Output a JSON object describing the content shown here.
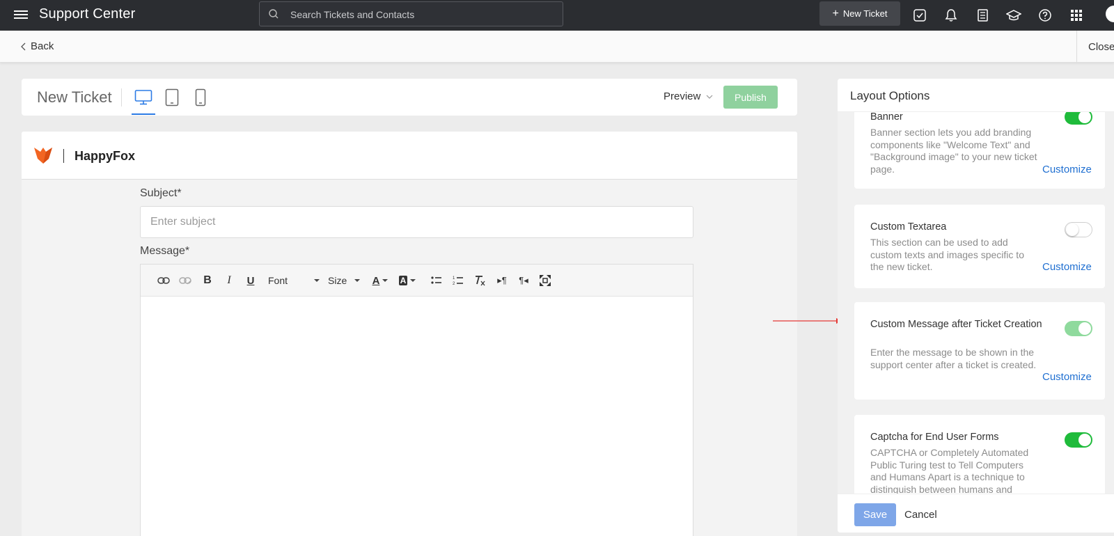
{
  "topbar": {
    "title": "Support Center",
    "search_placeholder": "Search Tickets and Contacts",
    "new_ticket_label": "New Ticket"
  },
  "subbar": {
    "back_label": "Back",
    "close_label": "Close"
  },
  "builder": {
    "title": "New Ticket",
    "preview_label": "Preview",
    "publish_label": "Publish",
    "devices": [
      "desktop",
      "tablet",
      "mobile"
    ],
    "active_device": "desktop"
  },
  "form": {
    "brand_name": "HappyFox",
    "subject_label": "Subject*",
    "subject_placeholder": "Enter subject",
    "message_label": "Message*",
    "font_label": "Font",
    "size_label": "Size"
  },
  "layout_options": {
    "title": "Layout Options",
    "items": [
      {
        "title": "Banner",
        "description": "Banner section lets you add branding components like \"Welcome Text\" and \"Background image\" to your new ticket page.",
        "enabled": true,
        "customize_label": "Customize"
      },
      {
        "title": "Custom Textarea",
        "description": "This section can be used to add custom texts and images specific to the new ticket.",
        "enabled": false,
        "customize_label": "Customize"
      },
      {
        "title": "Custom Message after Ticket Creation",
        "description": "Enter the message to be shown in the support center after a ticket is created.",
        "enabled": true,
        "customize_label": "Customize"
      },
      {
        "title": "Captcha for End User Forms",
        "description": "CAPTCHA or Completely Automated Public Turing test to Tell Computers and Humans Apart is a technique to distinguish between humans and",
        "enabled": true
      }
    ],
    "save_label": "Save",
    "cancel_label": "Cancel"
  },
  "colors": {
    "topbar": "#2b2d31",
    "accent_blue": "#2c7be5",
    "toggle_on": "#1fbb3b",
    "publish": "#8fd19e",
    "link": "#1f6fd1",
    "brand_orange": "#f26522",
    "annotation_arrow": "#e53935"
  }
}
